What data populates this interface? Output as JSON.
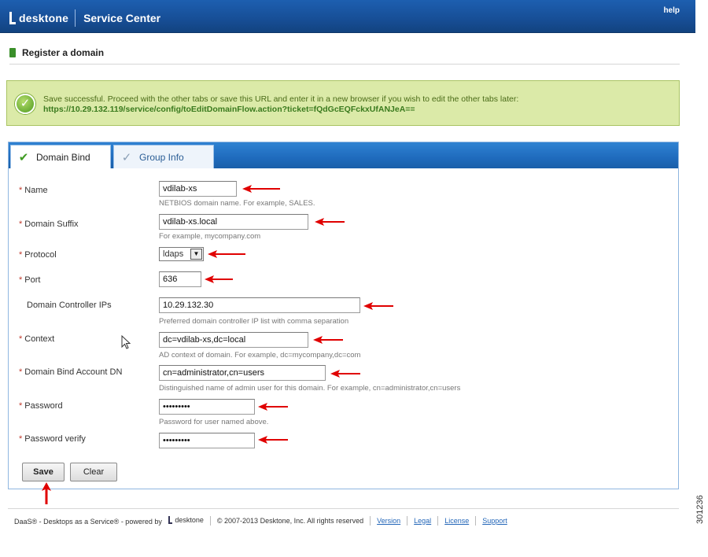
{
  "header": {
    "brand": "desktone",
    "app_title": "Service Center",
    "help": "help"
  },
  "page": {
    "title": "Register a domain"
  },
  "banner": {
    "message": "Save successful. Proceed with the other tabs or save this URL and enter it in a new browser if you wish to edit the other tabs later:",
    "url": "https://10.29.132.119/service/config/toEditDomainFlow.action?ticket=fQdGcEQFckxUfANJeA=="
  },
  "tabs": [
    {
      "label": "Domain Bind",
      "active": true
    },
    {
      "label": "Group Info",
      "active": false
    }
  ],
  "form": {
    "name": {
      "label": "Name",
      "value": "vdilab-xs",
      "hint": "NETBIOS domain name. For example, SALES."
    },
    "domain_suffix": {
      "label": "Domain Suffix",
      "value": "vdilab-xs.local",
      "hint": "For example, mycompany.com"
    },
    "protocol": {
      "label": "Protocol",
      "value": "ldaps"
    },
    "port": {
      "label": "Port",
      "value": "636"
    },
    "dc_ips": {
      "label": "Domain Controller IPs",
      "value": "10.29.132.30",
      "hint": "Preferred domain controller IP list with comma separation"
    },
    "context": {
      "label": "Context",
      "value": "dc=vdilab-xs,dc=local",
      "hint": "AD context of domain. For example, dc=mycompany,dc=com"
    },
    "bind_dn": {
      "label": "Domain Bind Account DN",
      "value": "cn=administrator,cn=users",
      "hint": "Distinguished name of admin user for this domain. For example, cn=administrator,cn=users"
    },
    "password": {
      "label": "Password",
      "value": "•••••••••",
      "hint": "Password for user named above."
    },
    "password_verify": {
      "label": "Password verify",
      "value": "•••••••••"
    },
    "required_mark": "*"
  },
  "buttons": {
    "save": "Save",
    "clear": "Clear"
  },
  "footer": {
    "tagline": "DaaS® - Desktops as a Service® - powered by",
    "brand": "desktone",
    "copyright": "© 2007-2013 Desktone, Inc. All rights reserved",
    "links": [
      "Version",
      "Legal",
      "License",
      "Support"
    ]
  },
  "figure_id": "301236",
  "colors": {
    "header": "#1d5fb0",
    "banner_bg": "#dbeaa8",
    "tab_strip": "#2f82d2",
    "annotation_arrow": "#e00000",
    "required": "#c0392b"
  }
}
